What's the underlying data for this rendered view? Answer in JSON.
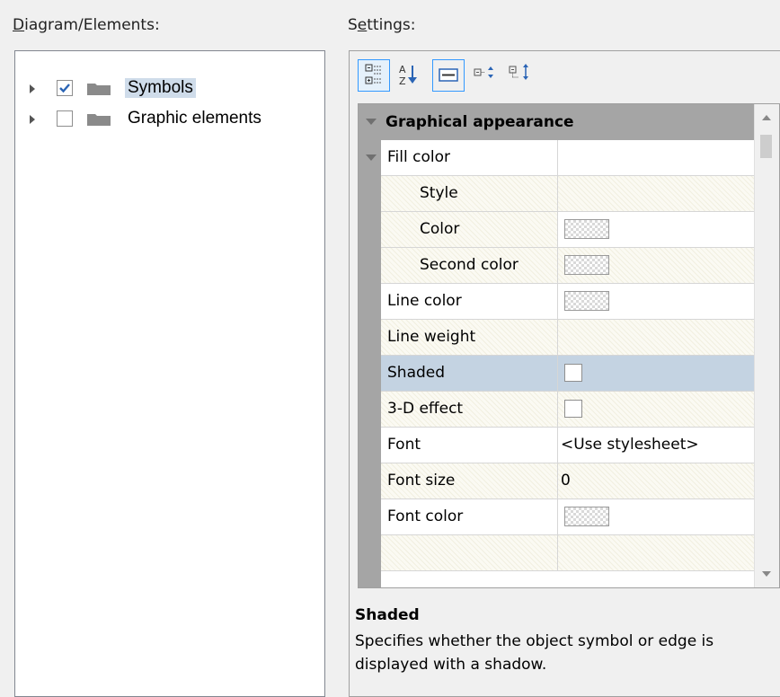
{
  "left_panel": {
    "label_first": "D",
    "label_rest": "iagram/Elements:",
    "tree": [
      {
        "label": "Symbols",
        "checked": true,
        "selected": true
      },
      {
        "label": "Graphic elements",
        "checked": false,
        "selected": false
      }
    ]
  },
  "right_panel": {
    "label_first": "S",
    "label_underlined": "e",
    "label_rest": "ttings:",
    "toolbar": [
      "categorized-view",
      "sort-alphabetical",
      "property-pages",
      "expand-all",
      "collapse-all"
    ],
    "group_title": "Graphical appearance",
    "properties": [
      {
        "name": "Fill color",
        "value": "",
        "kind": "category"
      },
      {
        "name": "Style",
        "value": "",
        "kind": "text",
        "indent": true
      },
      {
        "name": "Color",
        "value": "",
        "kind": "swatch",
        "indent": true
      },
      {
        "name": "Second color",
        "value": "",
        "kind": "swatch",
        "indent": true
      },
      {
        "name": "Line color",
        "value": "",
        "kind": "swatch"
      },
      {
        "name": "Line weight",
        "value": "",
        "kind": "text"
      },
      {
        "name": "Shaded",
        "value": "",
        "kind": "checkbox",
        "selected": true
      },
      {
        "name": "3-D effect",
        "value": "",
        "kind": "checkbox"
      },
      {
        "name": "Font",
        "value": "<Use stylesheet>",
        "kind": "text"
      },
      {
        "name": "Font size",
        "value": "0",
        "kind": "text"
      },
      {
        "name": "Font color",
        "value": "",
        "kind": "swatch"
      }
    ],
    "description": {
      "title": "Shaded",
      "text": "Specifies whether the object symbol or edge is displayed with a shadow."
    }
  },
  "colors": {
    "selection": "#c4d3e2",
    "tree_selection": "#cfdcea",
    "gutter": "#a5a5a5"
  }
}
